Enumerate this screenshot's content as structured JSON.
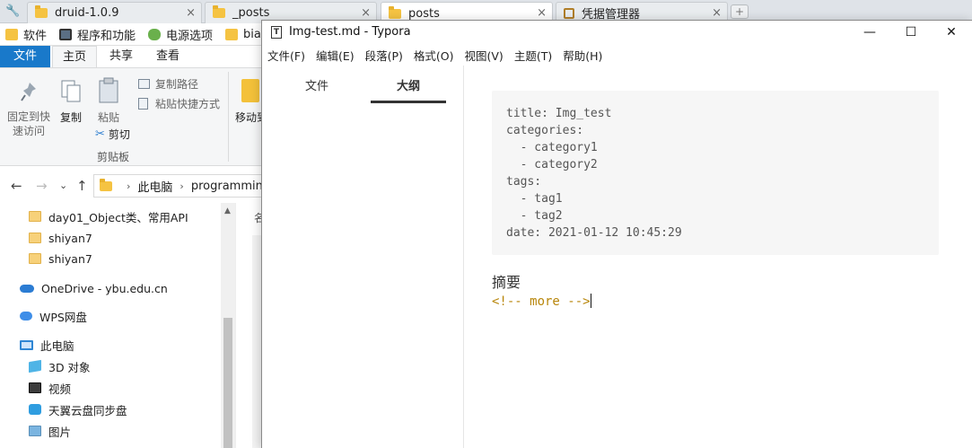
{
  "browser": {
    "tabs": [
      {
        "label": "druid-1.0.9",
        "close": "×"
      },
      {
        "label": "_posts",
        "close": "×"
      },
      {
        "label": "posts",
        "close": "×"
      },
      {
        "label": "凭据管理器",
        "close": "×"
      }
    ],
    "new_tab": "+",
    "bookmarks": [
      "软件",
      "程序和功能",
      "电源选项",
      "bianc"
    ]
  },
  "explorer": {
    "ribbon_tabs": [
      "文件",
      "主页",
      "共享",
      "查看"
    ],
    "ribbon": {
      "pin": "固定到快速访问",
      "copy": "复制",
      "paste": "粘贴",
      "copy_path": "复制路径",
      "paste_shortcut": "粘贴快捷方式",
      "cut": "剪切",
      "clipboard_group": "剪贴板",
      "move_to": "移动到"
    },
    "breadcrumb": [
      "此电脑",
      "programming"
    ],
    "column_header": "名",
    "nav_items": [
      {
        "label": "day01_Object类、常用API",
        "icon": "folder-icon"
      },
      {
        "label": "shiyan7",
        "icon": "folder-icon"
      },
      {
        "label": "shiyan7",
        "icon": "folder-icon"
      },
      {
        "label": "OneDrive - ybu.edu.cn",
        "icon": "onedrive-icon"
      },
      {
        "label": "WPS网盘",
        "icon": "wps-cloud-icon"
      },
      {
        "label": "此电脑",
        "icon": "this-pc-icon"
      },
      {
        "label": "3D 对象",
        "icon": "3d-objects-icon"
      },
      {
        "label": "视频",
        "icon": "video-icon"
      },
      {
        "label": "天翼云盘同步盘",
        "icon": "tianyi-cloud-icon"
      },
      {
        "label": "图片",
        "icon": "pictures-icon"
      }
    ]
  },
  "typora": {
    "title": "Img-test.md - Typora",
    "icon_letter": "T",
    "controls": {
      "minimize": "—",
      "maximize": "☐",
      "close": "✕"
    },
    "menu": [
      "文件(F)",
      "编辑(E)",
      "段落(P)",
      "格式(O)",
      "视图(V)",
      "主题(T)",
      "帮助(H)"
    ],
    "sidebar_tabs": [
      {
        "label": "文件",
        "active": false
      },
      {
        "label": "大纲",
        "active": true
      }
    ],
    "front_matter": "title: Img_test\ncategories:\n  - category1\n  - category2\ntags:\n  - tag1\n  - tag2\ndate: 2021-01-12 10:45:29",
    "summary_heading": "摘要",
    "more_comment": "<!-- more -->"
  },
  "colors": {
    "ribbon_file_tab": "#1979ca",
    "comment_text": "#b8860b",
    "code_block_bg": "#f6f6f6"
  }
}
